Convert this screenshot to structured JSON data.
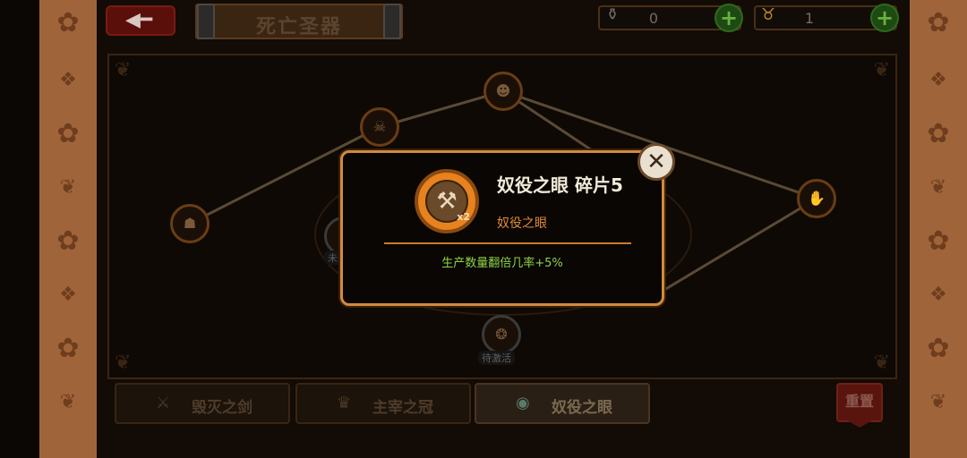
{
  "header": {
    "back_icon": "back-arrow-icon",
    "title": "死亡圣器",
    "resources": [
      {
        "icon": "potion-bottle-icon",
        "value": "0"
      },
      {
        "icon": "horned-mask-icon",
        "value": "1"
      }
    ]
  },
  "board": {
    "nodes": [
      {
        "icon": "helmet-icon",
        "label": ""
      },
      {
        "icon": "skull-icon",
        "label": ""
      },
      {
        "icon": "demon-face-icon",
        "label": ""
      },
      {
        "icon": "hand-icon",
        "label": ""
      },
      {
        "icon": "shadow-icon",
        "label": "未"
      },
      {
        "icon": "beast-icon",
        "label": "待激活"
      }
    ]
  },
  "tabs": [
    {
      "label": "毁灭之剑",
      "icon": "sword-icon",
      "active": false
    },
    {
      "label": "主宰之冠",
      "icon": "crown-icon",
      "active": false
    },
    {
      "label": "奴役之眼",
      "icon": "eye-orb-icon",
      "active": true
    }
  ],
  "reset_label": "重置",
  "dialog": {
    "item_icon": "hammer-icon",
    "multiplier": "x2",
    "name": "奴役之眼 碎片5",
    "type": "奴役之眼",
    "effect": "生产数量翻倍几率+5%",
    "close_icon": "close-icon"
  },
  "colors": {
    "dialog_border": "#d18a40",
    "dialog_type_text": "#e08a3a",
    "effect_text": "#8ed24a",
    "side_panel": "#a0643a"
  }
}
